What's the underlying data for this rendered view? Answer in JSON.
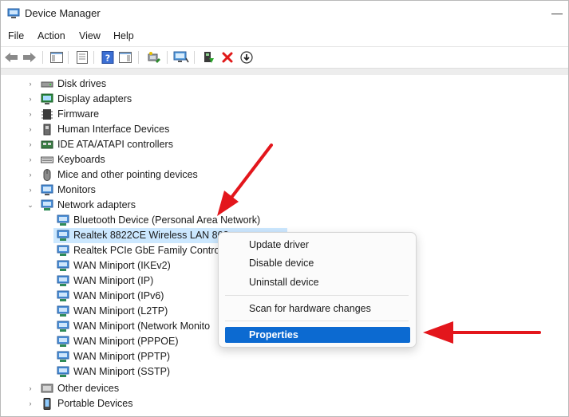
{
  "window": {
    "title": "Device Manager"
  },
  "menubar": {
    "items": [
      "File",
      "Action",
      "View",
      "Help"
    ]
  },
  "toolbar": {
    "buttons": [
      "back-icon",
      "forward-icon",
      "show-hide-console-tree-icon",
      "properties-icon",
      "help-icon",
      "action-pane-icon",
      "update-driver-icon",
      "scan-hardware-icon",
      "enable-device-icon",
      "uninstall-device-icon",
      "disable-device-icon"
    ]
  },
  "tree": {
    "categories_before": [
      {
        "label": "Disk drives",
        "icon": "disk-drive-icon"
      },
      {
        "label": "Display adapters",
        "icon": "display-adapter-icon"
      },
      {
        "label": "Firmware",
        "icon": "firmware-icon"
      },
      {
        "label": "Human Interface Devices",
        "icon": "hid-icon"
      },
      {
        "label": "IDE ATA/ATAPI controllers",
        "icon": "ide-controller-icon"
      },
      {
        "label": "Keyboards",
        "icon": "keyboard-icon"
      },
      {
        "label": "Mice and other pointing devices",
        "icon": "mouse-icon"
      },
      {
        "label": "Monitors",
        "icon": "monitor-icon"
      }
    ],
    "expanded_category": {
      "label": "Network adapters",
      "icon": "network-adapter-icon"
    },
    "network_devices": [
      "Bluetooth Device (Personal Area Network)",
      "Realtek 8822CE Wireless LAN 802",
      "Realtek PCIe GbE Family Controll",
      "WAN Miniport (IKEv2)",
      "WAN Miniport (IP)",
      "WAN Miniport (IPv6)",
      "WAN Miniport (L2TP)",
      "WAN Miniport (Network Monito",
      "WAN Miniport (PPPOE)",
      "WAN Miniport (PPTP)",
      "WAN Miniport (SSTP)"
    ],
    "selected_device_index": 1,
    "categories_after": [
      {
        "label": "Other devices",
        "icon": "other-devices-icon"
      },
      {
        "label": "Portable Devices",
        "icon": "portable-devices-icon"
      }
    ]
  },
  "context_menu": {
    "items": [
      "Update driver",
      "Disable device",
      "Uninstall device",
      "Scan for hardware changes",
      "Properties"
    ],
    "highlighted": "Properties"
  },
  "colors": {
    "selection": "#cce8ff",
    "menu_highlight": "#0c6ad1",
    "arrow": "#e3161c"
  }
}
